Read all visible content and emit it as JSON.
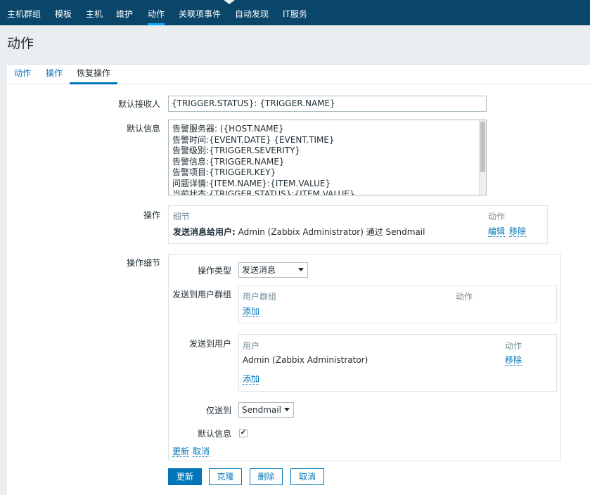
{
  "nav": {
    "items": [
      {
        "label": "主机群组"
      },
      {
        "label": "模板"
      },
      {
        "label": "主机"
      },
      {
        "label": "维护"
      },
      {
        "label": "动作"
      },
      {
        "label": "关联项事件"
      },
      {
        "label": "自动发现"
      },
      {
        "label": "IT服务"
      }
    ],
    "active": "动作"
  },
  "page": {
    "title": "动作"
  },
  "tabs": [
    {
      "label": "动作"
    },
    {
      "label": "操作"
    },
    {
      "label": "恢复操作"
    }
  ],
  "form": {
    "default_recipient_label": "默认接收人",
    "default_recipient_value": "{TRIGGER.STATUS}: {TRIGGER.NAME}",
    "default_message_label": "默认信息",
    "default_message_lines": [
      "告警服务器: ({HOST.NAME}",
      "告警时间:{EVENT.DATE} {EVENT.TIME}",
      "告警级别:{TRIGGER.SEVERITY}",
      "告警信息:{TRIGGER.NAME}",
      "告警项目:{TRIGGER.KEY}",
      "问题详情:{ITEM.NAME}:{ITEM.VALUE}",
      "当前状态:{TRIGGER.STATUS}:{ITEM.VALUE}"
    ],
    "operations_label": "操作",
    "operations": {
      "col_details": "细节",
      "col_action": "动作",
      "row_bold": "发送消息给用户:",
      "row_text": " Admin (Zabbix Administrator) 通过 Sendmail",
      "edit": "编辑",
      "remove": "移除"
    },
    "operation_details_label": "操作细节",
    "details": {
      "op_type_label": "操作类型",
      "op_type_value": "发送消息",
      "send_groups_label": "发送到用户群组",
      "groups_col": "用户群组",
      "groups_action_col": "动作",
      "groups_add": "添加",
      "send_users_label": "发送到用户",
      "users_col": "用户",
      "users_action_col": "动作",
      "user_name": "Admin (Zabbix Administrator)",
      "user_remove": "移除",
      "users_add": "添加",
      "send_only_label": "仅送到",
      "send_only_value": "Sendmail",
      "default_msg_label": "默认信息",
      "default_msg_checked": true,
      "update_link": "更新",
      "cancel_link": "取消"
    }
  },
  "buttons": {
    "update": "更新",
    "clone": "克隆",
    "delete": "删除",
    "cancel": "取消"
  },
  "colors": {
    "nav_bg": "#0a466a",
    "accent": "#0275b8",
    "active_tab": "#00aaff"
  }
}
